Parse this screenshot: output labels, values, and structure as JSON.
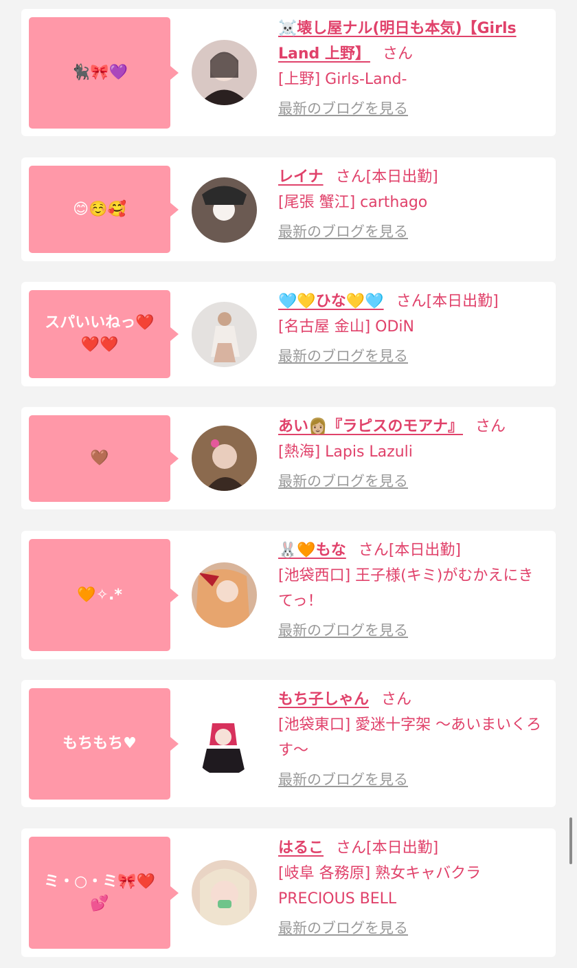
{
  "entries": [
    {
      "bubble": "🐈‍⬛🎀💜",
      "name": "☠️壊し屋ナル(明日も本気)【Girls Land 上野】",
      "suffix": "さん",
      "status": "",
      "shop": "[上野] Girls-Land-",
      "blog": "最新のブログを見る",
      "avatar_color": "#d9c8c4"
    },
    {
      "bubble": "😊☺️🥰",
      "name": "レイナ",
      "suffix": "さん",
      "status": "[本日出勤]",
      "shop": "[尾張 蟹江] carthago",
      "blog": "最新のブログを見る",
      "avatar_color": "#6b5a52"
    },
    {
      "bubble": "スパいいねっ❤️❤️❤️",
      "name": "🩵💛ひな💛🩵",
      "suffix": "さん",
      "status": "[本日出勤]",
      "shop": "[名古屋 金山] ODiN",
      "blog": "最新のブログを見る",
      "avatar_color": "#e4e1df"
    },
    {
      "bubble": "🤎",
      "name": "あい👩🏼『ラピスのモアナ』",
      "suffix": "さん",
      "status": "",
      "shop": "[熱海] Lapis Lazuli",
      "blog": "最新のブログを見る",
      "avatar_color": "#8b6a4e"
    },
    {
      "bubble": "🧡✧.*",
      "name": "🐰🧡もな",
      "suffix": "さん",
      "status": "[本日出勤]",
      "shop": "[池袋西口] 王子様(キミ)がむかえにきてっ！",
      "blog": "最新のブログを見る",
      "avatar_color": "#d8b49a"
    },
    {
      "bubble": "もちもち♥",
      "name": "もち子しゃん",
      "suffix": "さん",
      "status": "",
      "shop": "[池袋東口] 愛迷十字架 〜あいまいくろす〜",
      "blog": "最新のブログを見る",
      "avatar_color": "#ffffff"
    },
    {
      "bubble": "ミ・○・ミ🎀❤️💕",
      "name": "はるこ",
      "suffix": "さん",
      "status": "[本日出勤]",
      "shop": "[岐阜 各務原]  熟女キャバクラPRECIOUS BELL",
      "blog": "最新のブログを見る",
      "avatar_color": "#e9d4c4"
    }
  ]
}
